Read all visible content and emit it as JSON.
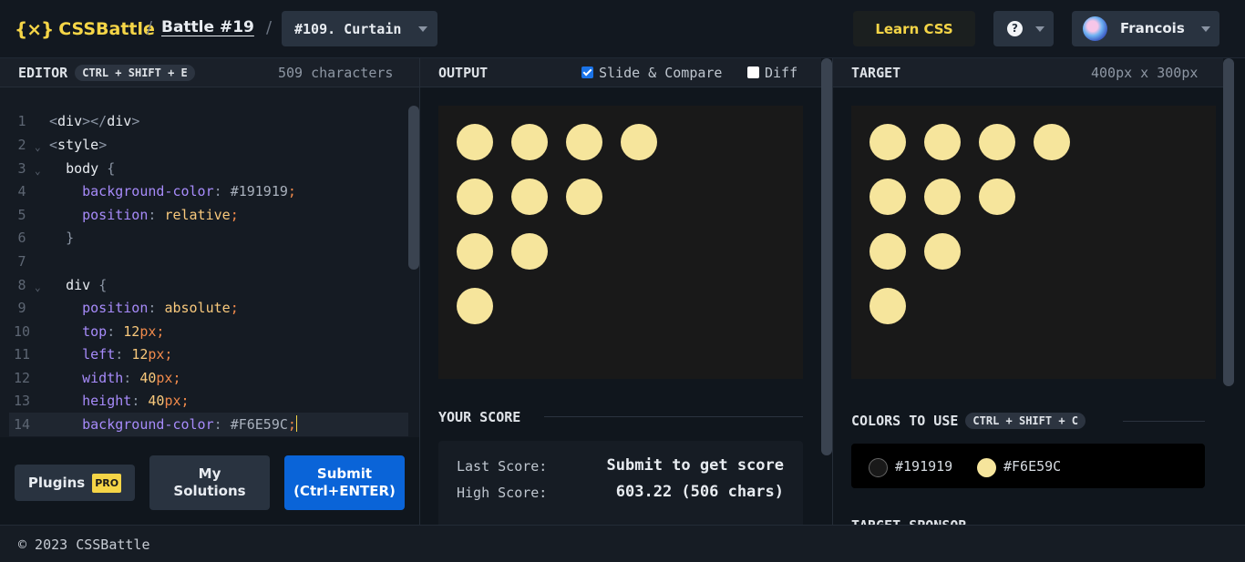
{
  "header": {
    "logo_text": "CSSBattle",
    "logo_mark": "{⨯}",
    "battle_label": "Battle #19",
    "target_selector": "#109. Curtain",
    "learn_label": "Learn CSS",
    "help_glyph": "?",
    "user_name": "Francois"
  },
  "editor": {
    "title": "EDITOR",
    "shortcut": "CTRL + SHIFT + E",
    "char_count": "509 characters",
    "line_numbers": [
      "1",
      "2",
      "3",
      "4",
      "5",
      "6",
      "7",
      "8",
      "9",
      "10",
      "11",
      "12",
      "13",
      "14"
    ]
  },
  "output": {
    "title": "OUTPUT",
    "slide_compare_label": "Slide & Compare",
    "slide_compare_checked": true,
    "diff_label": "Diff",
    "diff_checked": false
  },
  "target": {
    "title": "TARGET",
    "size_label": "400px x 300px",
    "colors_title": "COLORS TO USE",
    "colors_shortcut": "CTRL + SHIFT + C",
    "colors": [
      "#191919",
      "#F6E59C"
    ],
    "sponsor_title": "TARGET SPONSOR"
  },
  "score": {
    "title": "YOUR SCORE",
    "last_label": "Last Score:",
    "last_value": "Submit to get score",
    "high_label": "High Score:",
    "high_value": "603.22 (506 chars)"
  },
  "buttons": {
    "plugins": "Plugins",
    "pro": "PRO",
    "my_solutions": "My Solutions",
    "submit": "Submit (Ctrl+ENTER)"
  },
  "footer": {
    "copyright": "© 2023 CSSBattle"
  },
  "theme": {
    "accent": "#f5d547",
    "submit_blue": "#0a64d8",
    "canvas_bg": "#191919",
    "dot_color": "#F6E59C"
  }
}
